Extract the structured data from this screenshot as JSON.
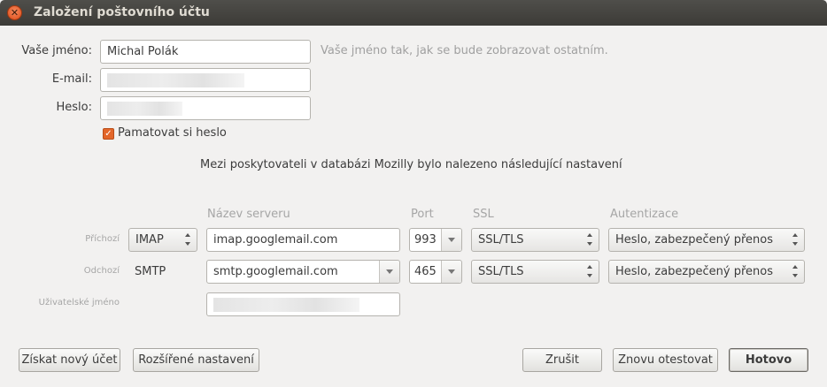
{
  "window": {
    "title": "Založení poštovního účtu",
    "close_glyph": "✕"
  },
  "form": {
    "name_label": "Vaše jméno:",
    "name_value": "Michal Polák",
    "name_hint": "Vaše jméno tak, jak se bude zobrazovat ostatním.",
    "email_label": "E-mail:",
    "password_label": "Heslo:",
    "remember_label": "Pamatovat si heslo",
    "remember_checked": true,
    "check_glyph": "✓"
  },
  "message": "Mezi poskytovateli v databázi Mozilly bylo nalezeno následující nastavení",
  "server_table": {
    "headers": {
      "server": "Název serveru",
      "port": "Port",
      "ssl": "SSL",
      "auth": "Autentizace"
    },
    "incoming": {
      "label": "Příchozí",
      "protocol": "IMAP",
      "server": "imap.googlemail.com",
      "port": "993",
      "ssl": "SSL/TLS",
      "auth": "Heslo, zabezpečený přenos"
    },
    "outgoing": {
      "label": "Odchozí",
      "protocol": "SMTP",
      "server": "smtp.googlemail.com",
      "port": "465",
      "ssl": "SSL/TLS",
      "auth": "Heslo, zabezpečený přenos"
    },
    "username_label": "Uživatelské jméno"
  },
  "buttons": {
    "new_account": "Získat nový účet",
    "advanced": "Rozšířené nastavení",
    "cancel": "Zrušit",
    "retest": "Znovu otestovat",
    "done": "Hotovo"
  }
}
